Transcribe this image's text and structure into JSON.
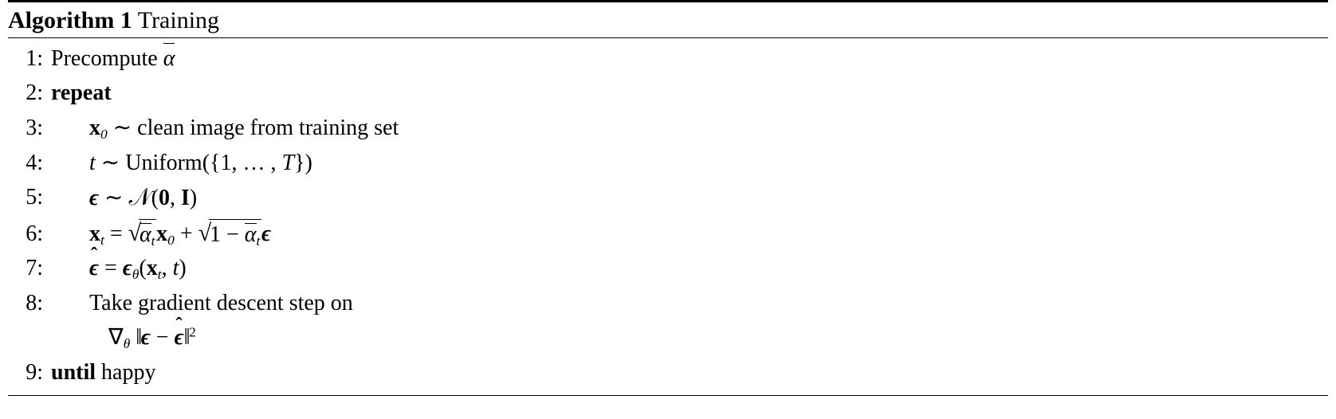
{
  "title": {
    "prefix": "Algorithm 1",
    "name": "Training"
  },
  "lines": [
    {
      "n": "1:",
      "text_precompute": "Precompute "
    },
    {
      "n": "2:",
      "kw_repeat": "repeat"
    },
    {
      "n": "3:",
      "x0": "x",
      "x0_sub": "0",
      "sim": " ∼ ",
      "text": "clean image from training set"
    },
    {
      "n": "4:",
      "t": "t",
      "sim": " ∼ ",
      "uniform": "Uniform",
      "args": "({1, … , ",
      "Tvar": "T",
      "args_close": "})"
    },
    {
      "n": "5:",
      "eps": "ϵ",
      "sim": " ∼ ",
      "N": "𝒩",
      "args_open": "(",
      "zero": "0",
      "comma": ", ",
      "I": "I",
      "args_close": ")"
    },
    {
      "n": "6:",
      "xt": "x",
      "xt_sub": "t",
      "eq": " = ",
      "alpha": "α",
      "alpha_sub": "t",
      "x0": "x",
      "x0_sub": "0",
      "plus": " + ",
      "one_minus": "1 − ",
      "eps": "ϵ"
    },
    {
      "n": "7:",
      "epshat": "ϵ",
      "eq": " = ",
      "eps": "ϵ",
      "theta_sub": "θ",
      "paren_open": "(",
      "xt": "x",
      "xt_sub": "t",
      "comma": ", ",
      "t": "t",
      "paren_close": ")"
    },
    {
      "n": "8:",
      "text": "Take gradient descent step on",
      "nabla": "∇",
      "theta_sub": "θ",
      "space": " ",
      "eps": "ϵ",
      "minus": " − ",
      "epshat": "ϵ",
      "exp": "2"
    },
    {
      "n": "9:",
      "kw_until": "until",
      "text": " happy"
    }
  ]
}
